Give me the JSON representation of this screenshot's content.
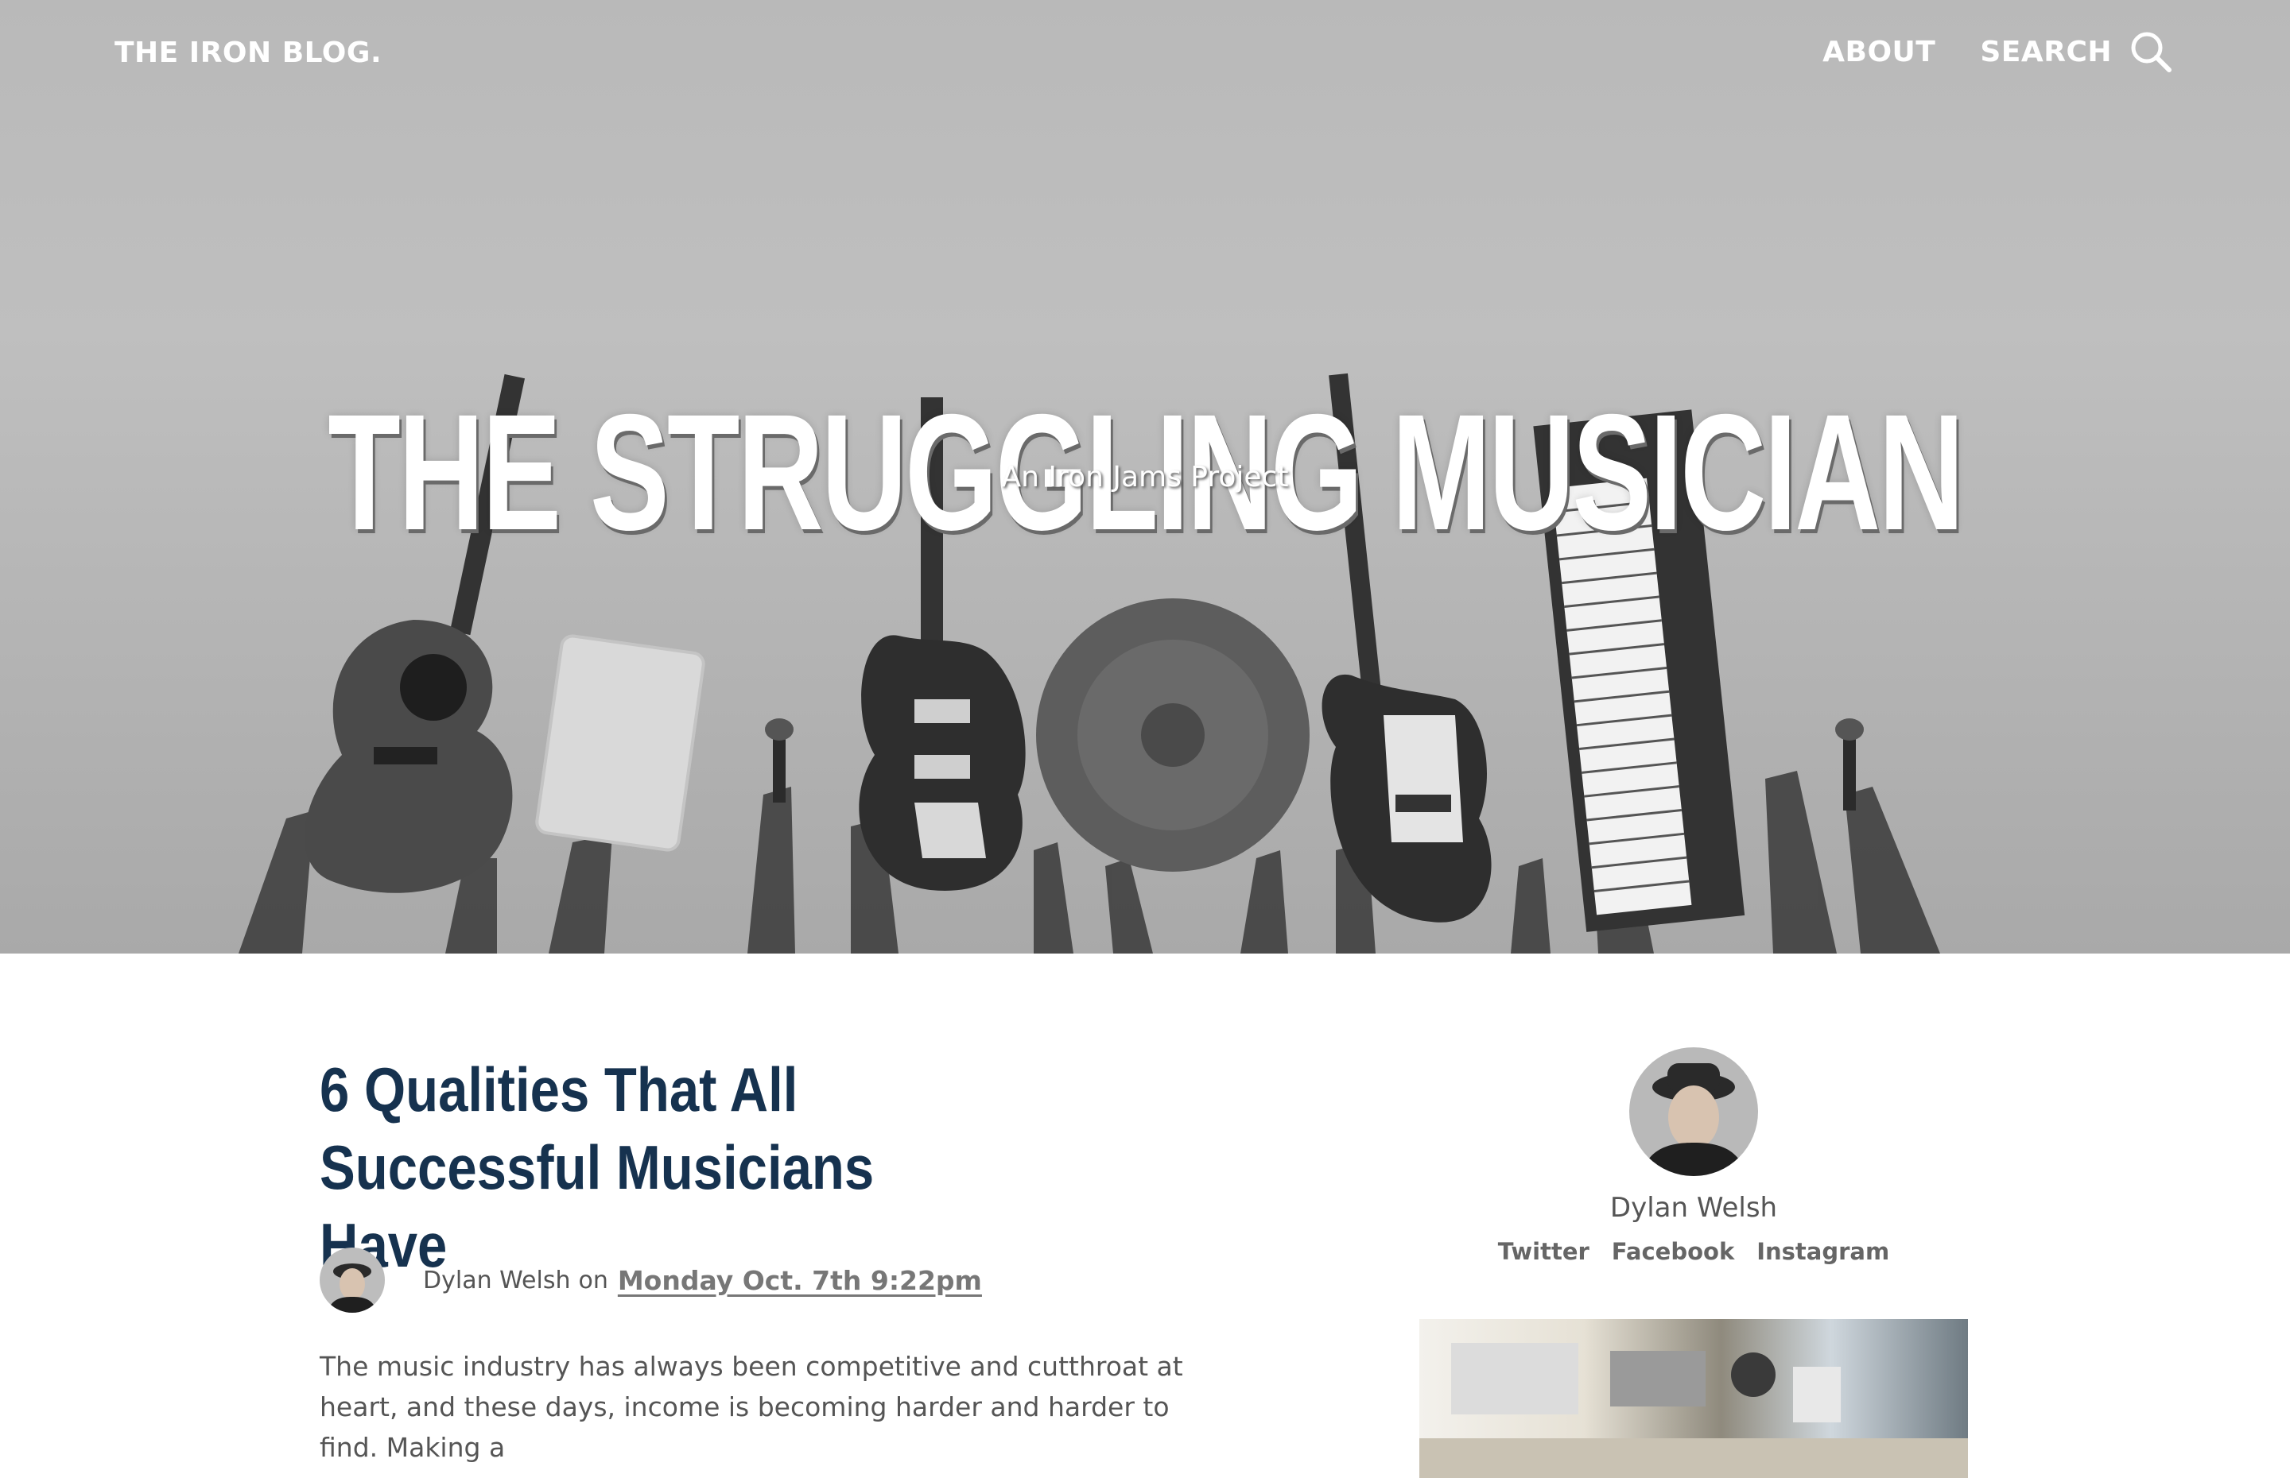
{
  "nav": {
    "brand": "THE IRON BLOG.",
    "about": "ABOUT",
    "search": "SEARCH"
  },
  "hero": {
    "title": "THE STRUGGLING MUSICIAN",
    "subtitle": "An Iron Jams Project"
  },
  "post": {
    "title": "6 Qualities That All Successful Musicians Have",
    "author": "Dylan Welsh",
    "on": "on",
    "date": "Monday Oct. 7th 9:22pm",
    "body": "The music industry has always been competitive and cutthroat at heart, and these days, income is becoming harder and harder to find. Making a"
  },
  "sidebar": {
    "author_name": "Dylan Welsh",
    "social": [
      "Twitter",
      "Facebook",
      "Instagram"
    ]
  },
  "colors": {
    "title_navy": "#16324f",
    "hero_gray": "#b9b9b9",
    "body_text": "#555555"
  },
  "icons": [
    "search-icon"
  ]
}
